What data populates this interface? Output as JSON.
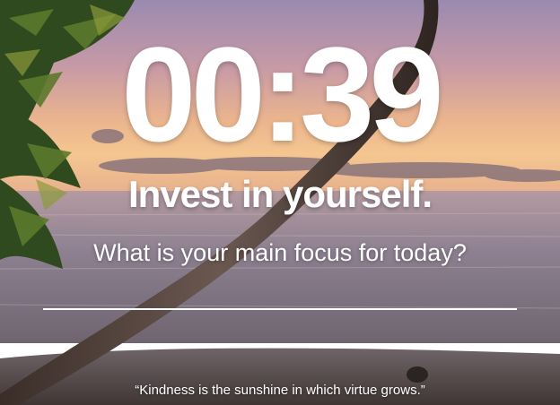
{
  "clock": {
    "time": "00:39"
  },
  "greeting": {
    "text": "Invest in yourself."
  },
  "focus": {
    "question": "What is your main focus for today?",
    "value": "",
    "placeholder": ""
  },
  "quote": {
    "text": "“Kindness is the sunshine in which virtue grows.”"
  },
  "background": {
    "description_icon": "beach-sunset-background",
    "sky_top": "#8e7fa6",
    "sky_mid": "#d9a28f",
    "horizon": "#f3c08c",
    "sea": "#8a7f8c",
    "sand": "#5b4a45"
  }
}
